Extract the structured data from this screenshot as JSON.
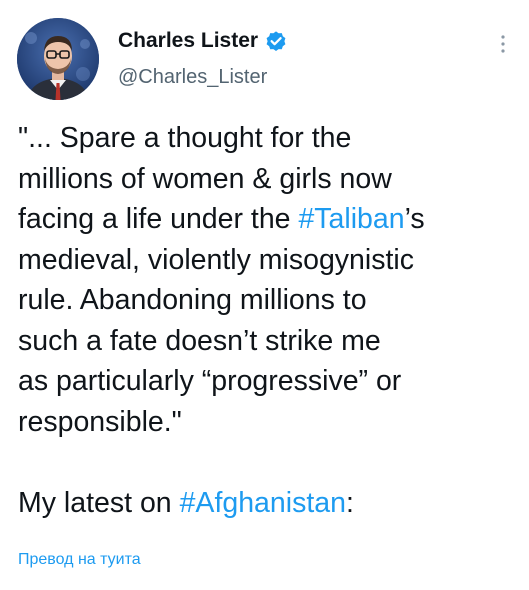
{
  "author": {
    "display_name": "Charles Lister",
    "handle": "@Charles_Lister",
    "verified": true
  },
  "tweet": {
    "lines": [
      [
        {
          "text": "\"... Spare a thought for the"
        }
      ],
      [
        {
          "text": "millions of women & girls now"
        }
      ],
      [
        {
          "text": "facing a life under the "
        },
        {
          "text": "#Taliban",
          "hashtag": true
        },
        {
          "text": "’s"
        }
      ],
      [
        {
          "text": "medieval, violently misogynistic"
        }
      ],
      [
        {
          "text": "rule. Abandoning millions to"
        }
      ],
      [
        {
          "text": "such a fate doesn’t strike me"
        }
      ],
      [
        {
          "text": "as particularly “progressive” or"
        }
      ],
      [
        {
          "text": "responsible.\""
        }
      ],
      [],
      [
        {
          "text": "My latest on "
        },
        {
          "text": "#Afghanistan",
          "hashtag": true
        },
        {
          "text": ":"
        }
      ]
    ]
  },
  "translate_label": "Превод на туита",
  "colors": {
    "link": "#1d9bf0",
    "text": "#0f1419",
    "secondary": "#536471",
    "verified_badge": "#1d9bf0"
  },
  "icons": {
    "verified": "verified-badge-icon",
    "more": "more-options-icon"
  }
}
